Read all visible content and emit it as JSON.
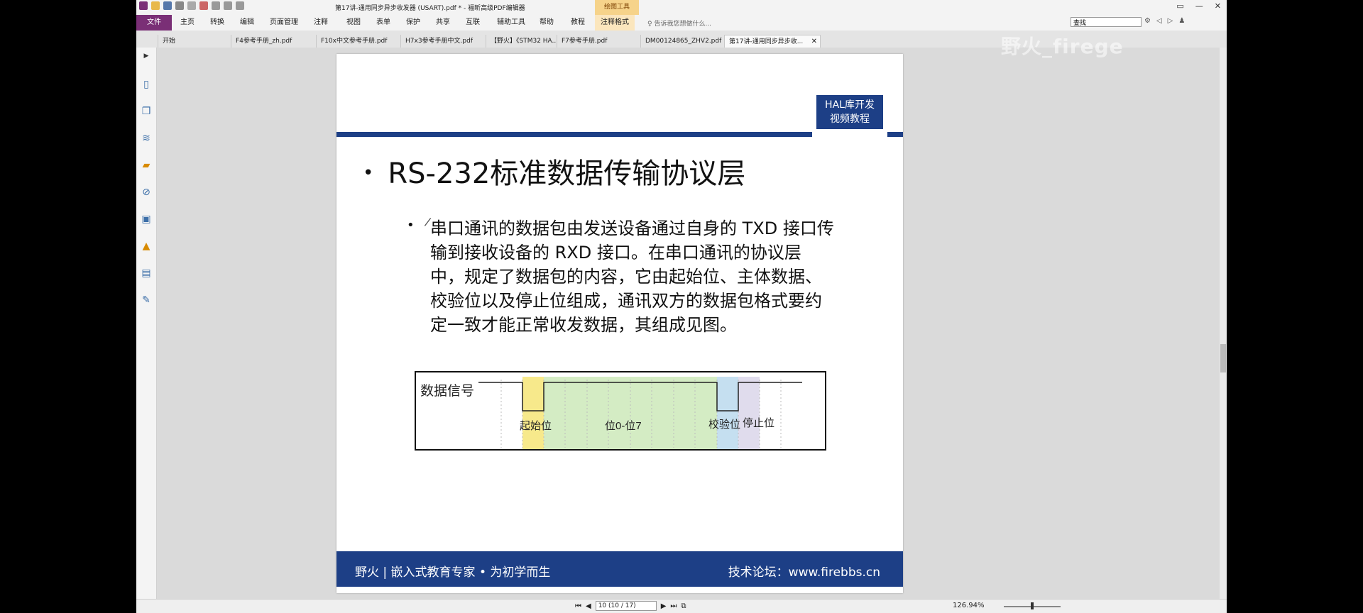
{
  "window": {
    "title": "第17讲-通用同步异步收发器 (USART).pdf * - 福昕高级PDF编辑器",
    "context_tab": "绘图工具",
    "controls": [
      "▭",
      "—",
      "✕"
    ]
  },
  "menu": {
    "file": "文件",
    "items": [
      "主页",
      "转换",
      "编辑",
      "页面管理",
      "注释",
      "视图",
      "表单",
      "保护",
      "共享",
      "互联",
      "辅助工具",
      "帮助",
      "教程"
    ],
    "annot_format": "注释格式",
    "tell_me": "告诉我您想做什么...",
    "search_value": "查找"
  },
  "tabs": [
    {
      "label": "开始"
    },
    {
      "label": "F4参考手册_zh.pdf"
    },
    {
      "label": "F10x中文参考手册.pdf"
    },
    {
      "label": "H7x3参考手册中文.pdf"
    },
    {
      "label": "【野火】《STM32 HA..."
    },
    {
      "label": "F7参考手册.pdf"
    },
    {
      "label": "DM00124865_ZHV2.pdf"
    },
    {
      "label": "第17讲-通用同步异步收..."
    }
  ],
  "tab_close": "✕",
  "slide": {
    "badge_line1": "HAL库开发",
    "badge_line2": "视频教程",
    "title": "RS-232标准数据传输协议层",
    "bullet": "•",
    "paragraph": "串口通讯的数据包由发送设备通过自身的 TXD 接口传输到接收设备的 RXD 接口。在串口通讯的协议层中，规定了数据包的内容，它由起始位、主体数据、校验位以及停止位组成，通讯双方的数据包格式要约定一致才能正常收发数据，其组成见图。",
    "footer_left": "野火 | 嵌入式教育专家 • 为初学而生",
    "footer_right": "技术论坛：www.firebbs.cn"
  },
  "diagram": {
    "signal_label": "数据信号",
    "start_label": "起始位",
    "data_label": "位0-位7",
    "parity_label": "校验位",
    "stop_label": "停止位",
    "colors": {
      "start": "#f7e98b",
      "data": "#d4ecc4",
      "parity": "#c5dff0",
      "stop": "#e0dced"
    }
  },
  "status": {
    "page_field": "10 (10 / 17)",
    "zoom": "126.94%"
  },
  "watermark": "野火_firege"
}
